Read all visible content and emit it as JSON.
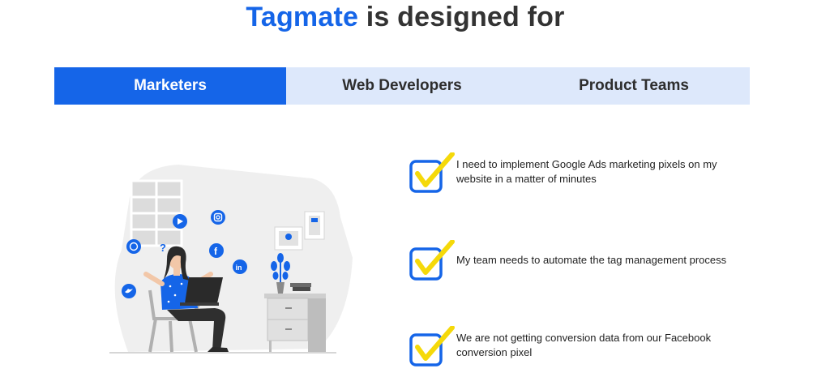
{
  "heading": {
    "brand": "Tagmate",
    "rest": " is designed for"
  },
  "tabs": [
    {
      "label": "Marketers",
      "active": true
    },
    {
      "label": "Web Developers",
      "active": false
    },
    {
      "label": "Product Teams",
      "active": false
    }
  ],
  "features": [
    {
      "text": "I need to implement Google Ads marketing pixels on my website in a matter of minutes"
    },
    {
      "text": "My team needs to automate the tag management process"
    },
    {
      "text": "We are not getting conversion data from our Facebook conversion pixel"
    }
  ],
  "colors": {
    "accent": "#1565e8",
    "tab_inactive": "#dde8fb",
    "check": "#f5d90a"
  }
}
